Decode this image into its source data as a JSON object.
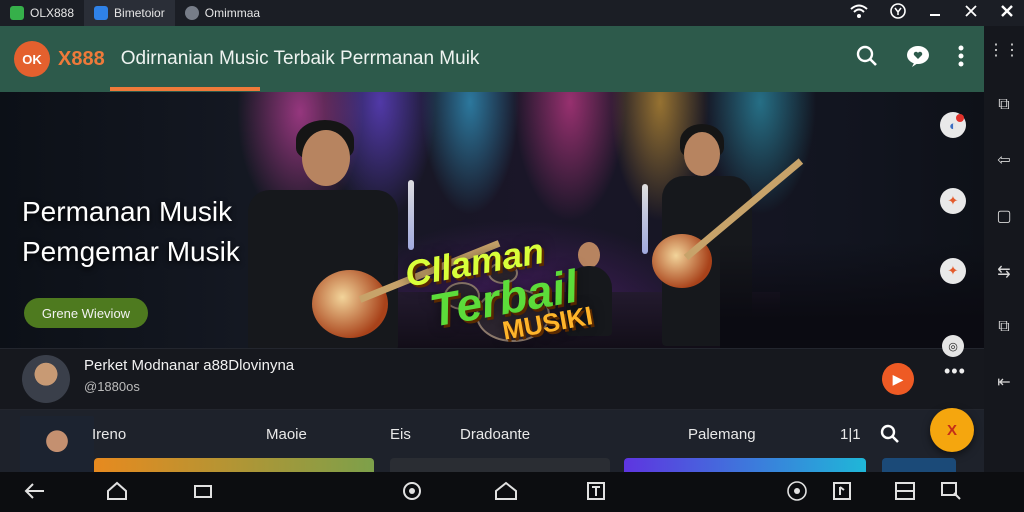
{
  "tabs": [
    {
      "label": "OLX888",
      "color": "#36b04a"
    },
    {
      "label": "Bimetoior",
      "color": "#2f82e8"
    },
    {
      "label": "Omimmaa",
      "color": "#777d88"
    }
  ],
  "status_icons": [
    "wifi-icon",
    "account-icon",
    "minimize-icon",
    "close-icon",
    "close-icon"
  ],
  "app": {
    "logo_text": "OK",
    "brand": "X888",
    "title": "Odirnanian Music  Terbaik Perrmanan Muik",
    "accent": "#ef7a3a",
    "header_bg": "#2d5a4b"
  },
  "hero": {
    "headline_1": "Permanan Musik",
    "headline_2": "Pemgemar Musik",
    "button_label": "Grene Wieviow",
    "badge_line_1": "CIlaman",
    "badge_line_2": "Terbail",
    "badge_line_3": "MUSIKI"
  },
  "info": {
    "title": "Perket Modnanar a88Dlovinyna",
    "subtitle": "@1880os",
    "play_symbol": "▶",
    "more_symbol": "•••"
  },
  "categories": [
    "Ireno",
    "Maoie",
    "Eis",
    "Dradoante",
    "Palemang",
    "1|1"
  ],
  "fab_label": "X",
  "card_colors": [
    "#e78a1f",
    "#2a2d33",
    "#5e35e0",
    "#1b4a78"
  ]
}
